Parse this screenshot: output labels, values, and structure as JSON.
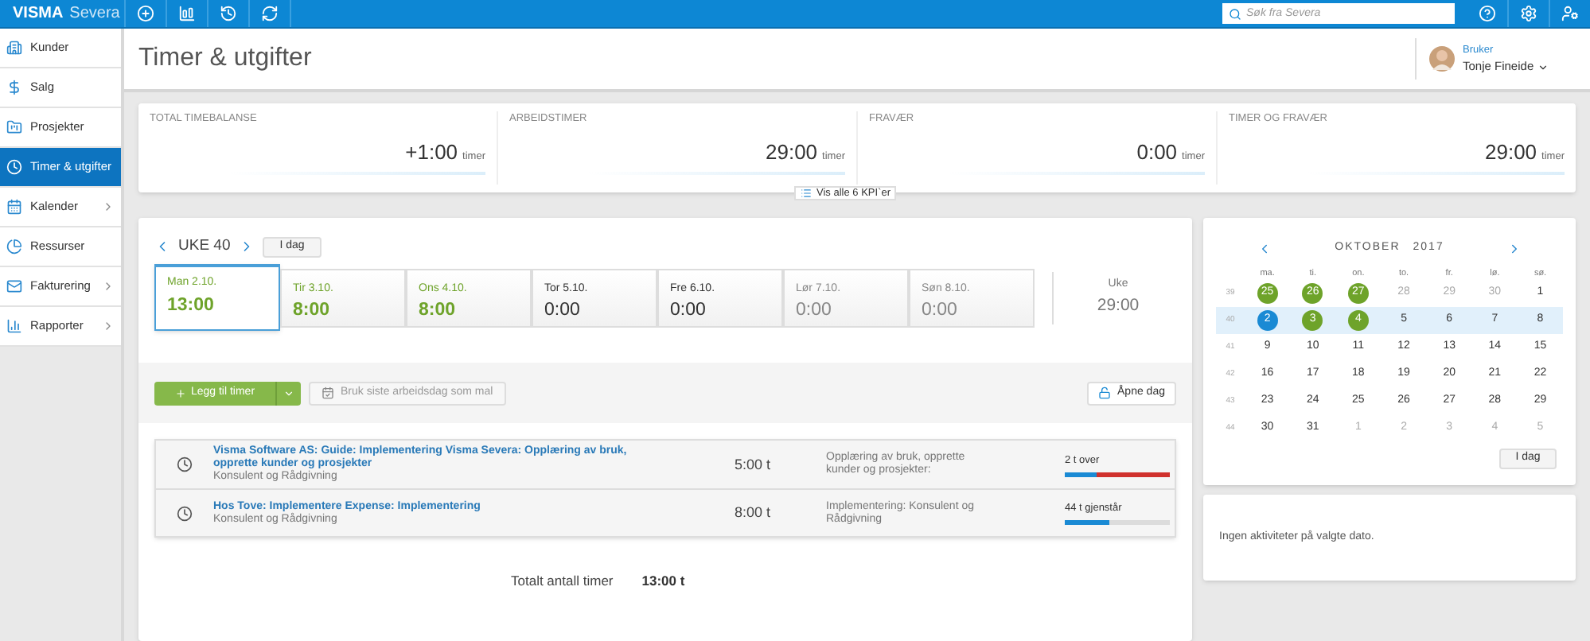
{
  "topbar": {
    "brand_bold": "VISMA",
    "brand_light": "Severa",
    "search": {
      "placeholder": "Søk fra Severa"
    }
  },
  "sidebar": {
    "items": [
      {
        "label": "Kunder",
        "selected": false,
        "expandable": false
      },
      {
        "label": "Salg",
        "selected": false,
        "expandable": false
      },
      {
        "label": "Prosjekter",
        "selected": false,
        "expandable": false
      },
      {
        "label": "Timer & utgifter",
        "selected": true,
        "expandable": false
      },
      {
        "label": "Kalender",
        "selected": false,
        "expandable": true
      },
      {
        "label": "Ressurser",
        "selected": false,
        "expandable": false
      },
      {
        "label": "Fakturering",
        "selected": false,
        "expandable": true
      },
      {
        "label": "Rapporter",
        "selected": false,
        "expandable": true
      }
    ]
  },
  "header": {
    "title": "Timer & utgifter",
    "user_role": "Bruker",
    "user_name": "Tonje Fineide"
  },
  "kpis": [
    {
      "label": "TOTAL TIMEBALANSE",
      "value": "+1:00",
      "unit": "timer"
    },
    {
      "label": "ARBEIDSTIMER",
      "value": "29:00",
      "unit": "timer"
    },
    {
      "label": "FRAVÆR",
      "value": "0:00",
      "unit": "timer"
    },
    {
      "label": "TIMER OG FRAVÆR",
      "value": "29:00",
      "unit": "timer"
    }
  ],
  "kpi_button": "Vis alle 6 KPI`er",
  "week": {
    "title": "UKE 40",
    "today_button": "I dag",
    "days": [
      {
        "label": "Man 2.10.",
        "hours": "13:00",
        "kind": "logged",
        "selected": true
      },
      {
        "label": "Tir 3.10.",
        "hours": "8:00",
        "kind": "logged",
        "selected": false
      },
      {
        "label": "Ons 4.10.",
        "hours": "8:00",
        "kind": "logged",
        "selected": false
      },
      {
        "label": "Tor 5.10.",
        "hours": "0:00",
        "kind": "workday",
        "selected": false
      },
      {
        "label": "Fre 6.10.",
        "hours": "0:00",
        "kind": "workday",
        "selected": false
      },
      {
        "label": "Lør 7.10.",
        "hours": "0:00",
        "kind": "weekend",
        "selected": false
      },
      {
        "label": "Søn 8.10.",
        "hours": "0:00",
        "kind": "weekend",
        "selected": false
      }
    ],
    "total_label": "Uke",
    "total": "29:00"
  },
  "actions": {
    "add": "Legg til timer",
    "template": "Bruk siste arbeidsdag som mal",
    "open_day": "Åpne dag"
  },
  "entries": [
    {
      "title": "Visma Software AS:  Guide: Implementering Visma Severa: Opplæring av bruk, opprette kunder og prosjekter",
      "subtitle": "Konsulent og Rådgivning",
      "hours": "5:00 t",
      "description": "Opplæring av bruk, opprette kunder og prosjekter:",
      "budget": "2 t over",
      "kind": "over",
      "level": 0.3
    },
    {
      "title": "Hos Tove:  Implementere Expense: Implementering",
      "subtitle": "Konsulent og Rådgivning",
      "hours": "8:00 t",
      "description": "Implementering: Konsulent og Rådgivning",
      "budget": "44 t gjenstår",
      "kind": "remaining",
      "level": 0.42
    }
  ],
  "total": {
    "label": "Totalt antall timer",
    "value": "13:00 t"
  },
  "calendar": {
    "month": "OKTOBER",
    "year": "2017",
    "weekdays": [
      "ma.",
      "ti.",
      "on.",
      "to.",
      "fr.",
      "lø.",
      "sø."
    ],
    "today_button": "I dag",
    "weeks": [
      {
        "number": "39",
        "selected": false,
        "days": [
          {
            "label": "25",
            "kind": "logged"
          },
          {
            "label": "26",
            "kind": "logged"
          },
          {
            "label": "27",
            "kind": "logged"
          },
          {
            "label": "28",
            "kind": "outside"
          },
          {
            "label": "29",
            "kind": "outside"
          },
          {
            "label": "30",
            "kind": "outside"
          },
          {
            "label": "1",
            "kind": "plain"
          }
        ]
      },
      {
        "number": "40",
        "selected": true,
        "days": [
          {
            "label": "2",
            "kind": "current"
          },
          {
            "label": "3",
            "kind": "logged"
          },
          {
            "label": "4",
            "kind": "logged"
          },
          {
            "label": "5",
            "kind": "plain"
          },
          {
            "label": "6",
            "kind": "plain"
          },
          {
            "label": "7",
            "kind": "plain"
          },
          {
            "label": "8",
            "kind": "plain"
          }
        ]
      },
      {
        "number": "41",
        "selected": false,
        "days": [
          {
            "label": "9",
            "kind": "plain"
          },
          {
            "label": "10",
            "kind": "plain"
          },
          {
            "label": "11",
            "kind": "plain"
          },
          {
            "label": "12",
            "kind": "plain"
          },
          {
            "label": "13",
            "kind": "plain"
          },
          {
            "label": "14",
            "kind": "plain"
          },
          {
            "label": "15",
            "kind": "plain"
          }
        ]
      },
      {
        "number": "42",
        "selected": false,
        "days": [
          {
            "label": "16",
            "kind": "plain"
          },
          {
            "label": "17",
            "kind": "plain"
          },
          {
            "label": "18",
            "kind": "plain"
          },
          {
            "label": "19",
            "kind": "plain"
          },
          {
            "label": "20",
            "kind": "plain"
          },
          {
            "label": "21",
            "kind": "plain"
          },
          {
            "label": "22",
            "kind": "plain"
          }
        ]
      },
      {
        "number": "43",
        "selected": false,
        "days": [
          {
            "label": "23",
            "kind": "plain"
          },
          {
            "label": "24",
            "kind": "plain"
          },
          {
            "label": "25",
            "kind": "plain"
          },
          {
            "label": "26",
            "kind": "plain"
          },
          {
            "label": "27",
            "kind": "plain"
          },
          {
            "label": "28",
            "kind": "plain"
          },
          {
            "label": "29",
            "kind": "plain"
          }
        ]
      },
      {
        "number": "44",
        "selected": false,
        "days": [
          {
            "label": "30",
            "kind": "plain"
          },
          {
            "label": "31",
            "kind": "plain"
          },
          {
            "label": "1",
            "kind": "outside"
          },
          {
            "label": "2",
            "kind": "outside"
          },
          {
            "label": "3",
            "kind": "outside"
          },
          {
            "label": "4",
            "kind": "outside"
          },
          {
            "label": "5",
            "kind": "outside"
          }
        ]
      }
    ]
  },
  "activities": {
    "empty_text": "Ingen aktiviteter på valgte dato."
  }
}
